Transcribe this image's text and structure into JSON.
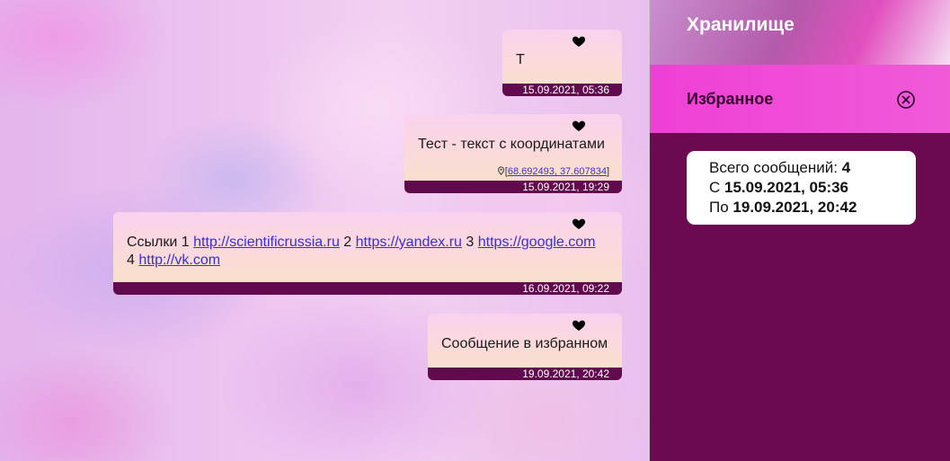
{
  "messages": [
    {
      "text": "Т",
      "time": "15.09.2021, 05:36"
    },
    {
      "text": "Тест - текст с координатами",
      "coords": "68.692493, 37.607834",
      "time": "15.09.2021, 19:29"
    },
    {
      "text_prefix_1": "Ссылки 1 ",
      "link_1": "http://scientificrussia.ru",
      "text_prefix_2": " 2 ",
      "link_2": "https://yandex.ru",
      "text_prefix_3": " 3 ",
      "link_3": "https://google.com",
      "text_prefix_4": "4 ",
      "link_4": "http://vk.com",
      "time": "16.09.2021, 09:22"
    },
    {
      "text": "Сообщение в избранном",
      "time": "19.09.2021, 20:42"
    }
  ],
  "panel": {
    "title": "Хранилище",
    "favorites_label": "Избранное",
    "stats": {
      "total_label": "Всего сообщений: ",
      "total_value": "4",
      "from_label": "С ",
      "from_value": "15.09.2021, 05:36",
      "to_label": "По ",
      "to_value": "19.09.2021, 20:42"
    }
  },
  "colors": {
    "panel_bg": "#6b0a51",
    "favorites_bar": "#ef3fd6",
    "time_bar": "#620a4e",
    "link": "#3a2fd6"
  },
  "icons": {
    "favorite": "heart-icon",
    "close": "close-circle-icon",
    "location": "location-pin-icon"
  }
}
